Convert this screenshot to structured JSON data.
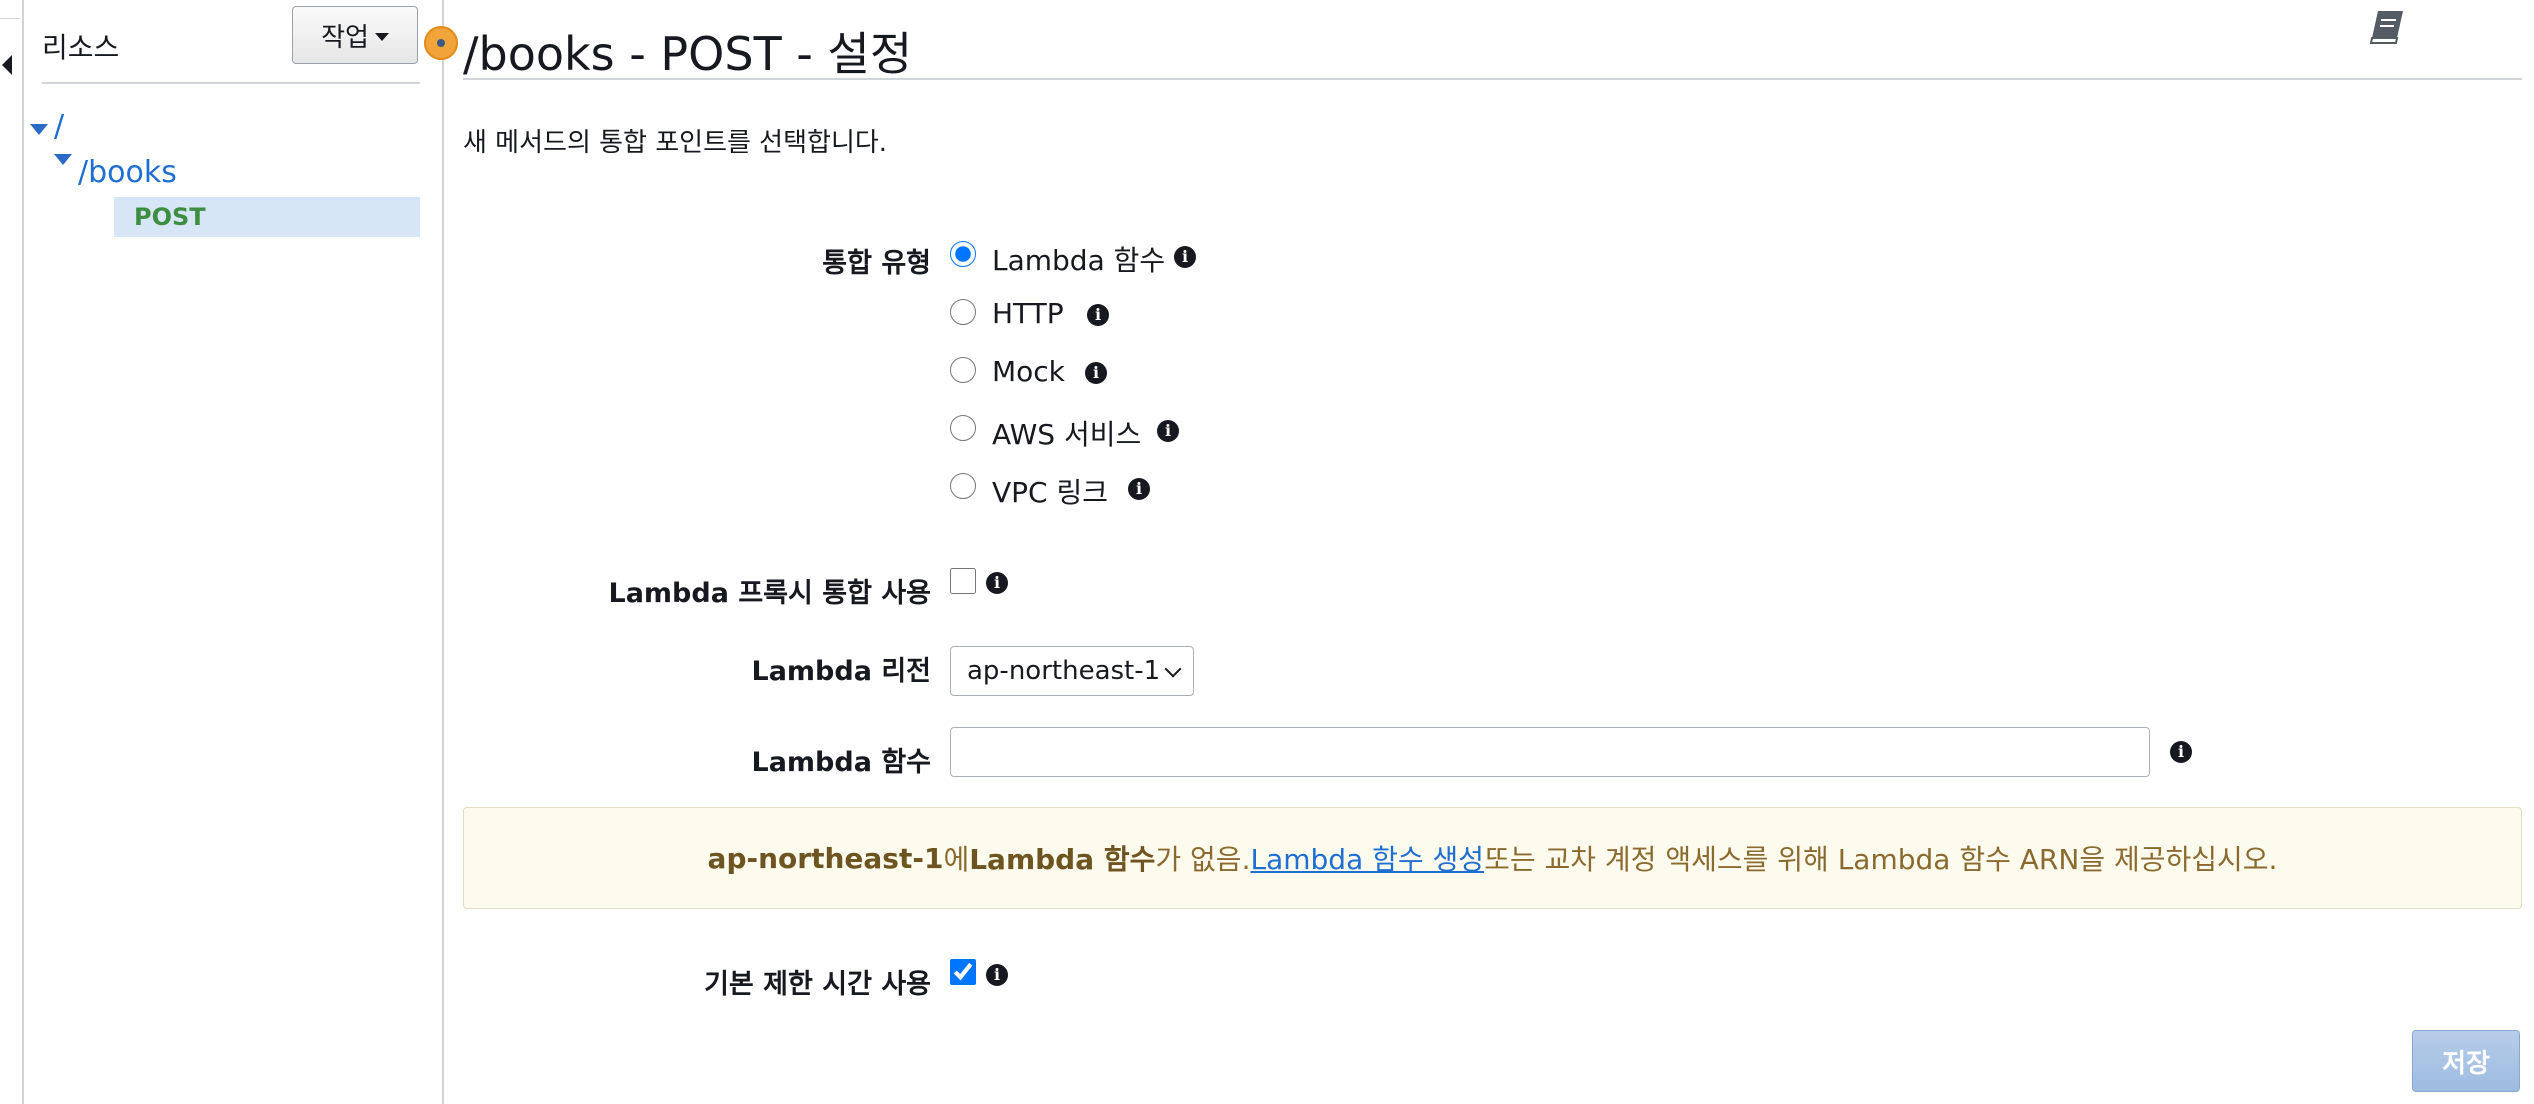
{
  "resources": {
    "title": "리소스",
    "actions_label": "작업",
    "tree": {
      "root_label": "/",
      "books_label": "/books",
      "method_label": "POST"
    }
  },
  "page": {
    "title": "/books - POST - 설정",
    "intro": "새 메서드의 통합 포인트를 선택합니다."
  },
  "integration": {
    "label": "통합 유형",
    "options": [
      {
        "label": "Lambda 함수",
        "selected": true
      },
      {
        "label": "HTTP",
        "selected": false
      },
      {
        "label": "Mock",
        "selected": false
      },
      {
        "label": "AWS 서비스",
        "selected": false
      },
      {
        "label": "VPC 링크",
        "selected": false
      }
    ]
  },
  "proxy": {
    "label": "Lambda 프록시 통합 사용",
    "checked": false
  },
  "region": {
    "label": "Lambda 리전",
    "value": "ap-northeast-1"
  },
  "function": {
    "label": "Lambda 함수",
    "value": "",
    "placeholder": ""
  },
  "alert": {
    "region": "ap-northeast-1",
    "text_1": "에 ",
    "bold_2": "Lambda 함수",
    "text_3": "가 없음. ",
    "link": "Lambda 함수 생성",
    "text_4": " 또는 교차 계정 액세스를 위해 Lambda 함수 ARN을 제공하십시오."
  },
  "timeout": {
    "label": "기본 제한 시간 사용",
    "checked": true
  },
  "save_label": "저장",
  "icons": {
    "info": "info-icon",
    "docs": "book-icon",
    "collapse": "caret-left-icon"
  },
  "colors": {
    "link": "#1f6fd0",
    "post_method": "#3e8e41",
    "selected_row": "#d7e6f7",
    "alert_bg": "#fdfbee",
    "save_button": "#9dbbe0",
    "splitter_handle": "#f0a43a"
  }
}
